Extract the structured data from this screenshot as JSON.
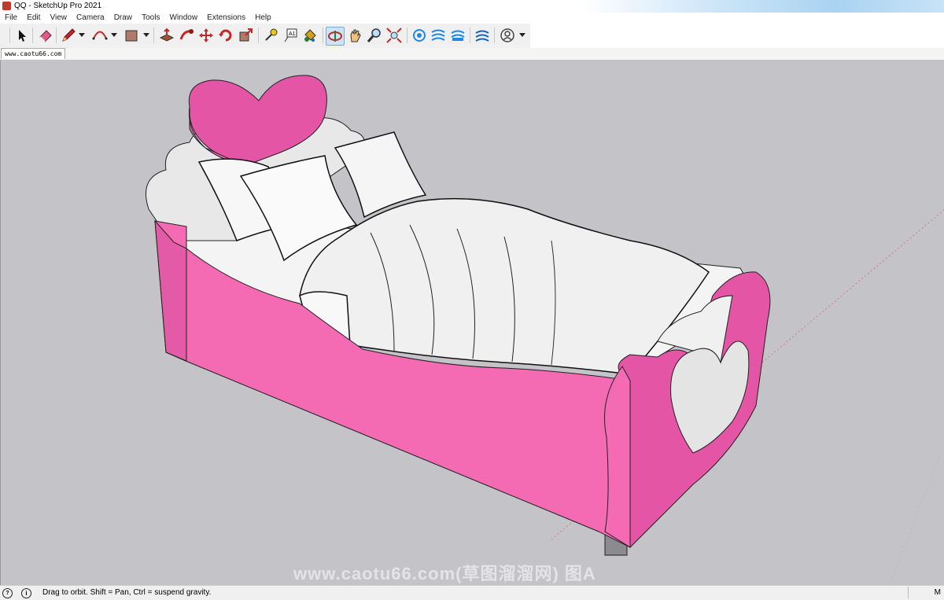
{
  "window": {
    "title": "QQ - SketchUp Pro 2021"
  },
  "menu": [
    "File",
    "Edit",
    "View",
    "Camera",
    "Draw",
    "Tools",
    "Window",
    "Extensions",
    "Help"
  ],
  "toolbar": {
    "tools": [
      "select-icon",
      "eraser-icon",
      "pencil-icon",
      "arc-icon",
      "rectangle-icon",
      "push-pull-icon",
      "follow-me-icon",
      "move-icon",
      "rotate-icon",
      "scale-icon",
      "tape-measure-icon",
      "text-icon",
      "paint-bucket-icon",
      "orbit-icon",
      "pan-icon",
      "zoom-icon",
      "zoom-extents-icon",
      "warehouse-icon",
      "extension-icon",
      "extension-manager-icon",
      "sandbox-icon",
      "account-icon"
    ],
    "active_tool": "orbit-icon"
  },
  "scene_tab": {
    "label": "www.caotu66.com"
  },
  "watermark": {
    "text": "www.caotu66.com(草图溜溜网) 图A"
  },
  "status": {
    "message": "Drag to orbit. Shift = Pan, Ctrl = suspend gravity.",
    "right_label": "M"
  },
  "colors": {
    "viewport_bg": "#c3c3c8",
    "bed_pink": "#f46ab3",
    "heart_pink": "#e455a6",
    "linen": "#f2f2f2"
  }
}
